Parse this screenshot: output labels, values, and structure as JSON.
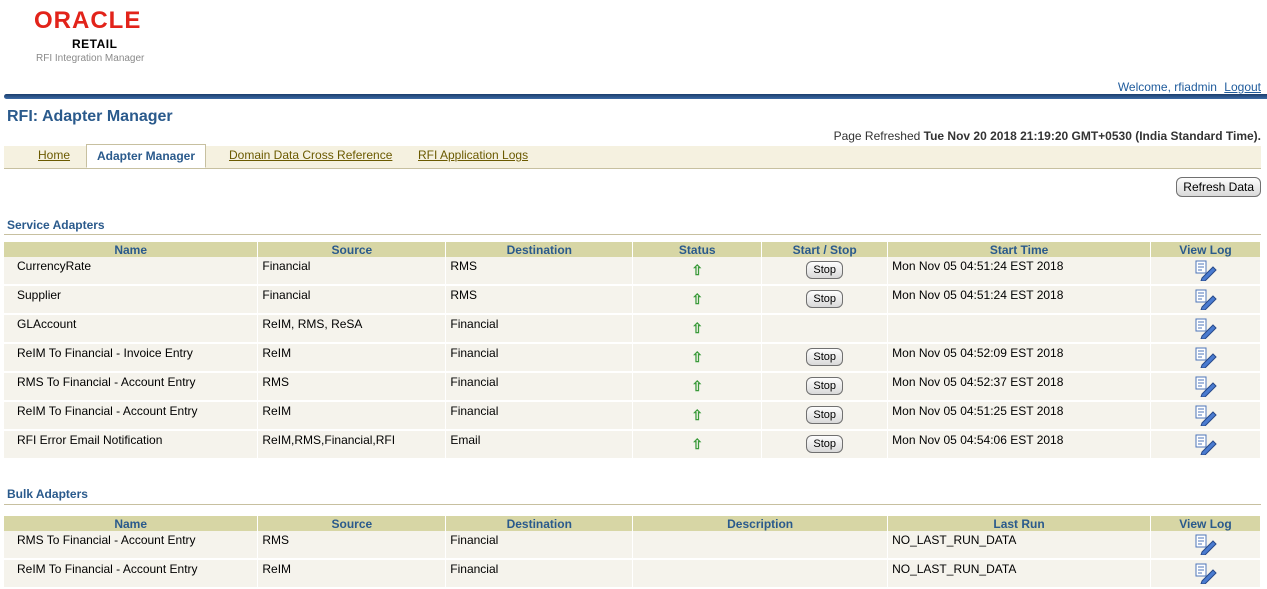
{
  "branding": {
    "oracle": "ORACLE",
    "retail": "RETAIL",
    "product": "RFI Integration Manager"
  },
  "user": {
    "welcome": "Welcome, rfiadmin",
    "logout": "Logout"
  },
  "page": {
    "title": "RFI: Adapter Manager",
    "refreshed_label": "Page Refreshed",
    "refreshed_value": "Tue Nov 20 2018 21:19:20 GMT+0530 (India Standard Time)."
  },
  "tabs": [
    {
      "label": "Home"
    },
    {
      "label": "Adapter Manager"
    },
    {
      "label": "Domain Data Cross Reference"
    },
    {
      "label": "RFI Application Logs"
    }
  ],
  "refresh_button": "Refresh Data",
  "service": {
    "title": "Service Adapters",
    "headers": [
      "Name",
      "Source",
      "Destination",
      "Status",
      "Start / Stop",
      "Start Time",
      "View Log"
    ],
    "rows": [
      {
        "name": "CurrencyRate",
        "source": "Financial",
        "destination": "RMS",
        "action": "Stop",
        "start_time": "Mon Nov 05 04:51:24 EST 2018"
      },
      {
        "name": "Supplier",
        "source": "Financial",
        "destination": "RMS",
        "action": "Stop",
        "start_time": "Mon Nov 05 04:51:24 EST 2018"
      },
      {
        "name": "GLAccount",
        "source": "ReIM, RMS, ReSA",
        "destination": "Financial",
        "action": "",
        "start_time": ""
      },
      {
        "name": "ReIM To Financial - Invoice Entry",
        "source": "ReIM",
        "destination": "Financial",
        "action": "Stop",
        "start_time": "Mon Nov 05 04:52:09 EST 2018"
      },
      {
        "name": "RMS To Financial - Account Entry",
        "source": "RMS",
        "destination": "Financial",
        "action": "Stop",
        "start_time": "Mon Nov 05 04:52:37 EST 2018"
      },
      {
        "name": "ReIM To Financial - Account Entry",
        "source": "ReIM",
        "destination": "Financial",
        "action": "Stop",
        "start_time": "Mon Nov 05 04:51:25 EST 2018"
      },
      {
        "name": "RFI Error Email Notification",
        "source": "ReIM,RMS,Financial,RFI",
        "destination": "Email",
        "action": "Stop",
        "start_time": "Mon Nov 05 04:54:06 EST 2018"
      }
    ]
  },
  "bulk": {
    "title": "Bulk Adapters",
    "headers": [
      "Name",
      "Source",
      "Destination",
      "Description",
      "Last Run",
      "View Log"
    ],
    "rows": [
      {
        "name": "RMS To Financial - Account Entry",
        "source": "RMS",
        "destination": "Financial",
        "description": "",
        "last_run": "NO_LAST_RUN_DATA"
      },
      {
        "name": "ReIM To Financial - Account Entry",
        "source": "ReIM",
        "destination": "Financial",
        "description": "",
        "last_run": "NO_LAST_RUN_DATA"
      }
    ]
  },
  "colors": {
    "accent": "#2a5a8c",
    "header_bg": "#d7d6a5",
    "row_bg": "#f5f3ec",
    "status_up": "#3a9a3a",
    "oracle_red": "#e2231a"
  },
  "icons": {
    "status": "up-arrow-icon",
    "view_log": "view-log-icon"
  }
}
